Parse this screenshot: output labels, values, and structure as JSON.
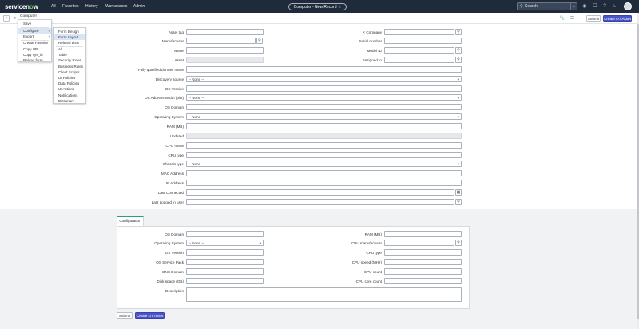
{
  "topbar": {
    "logo_text_a": "servicen",
    "logo_text_o": "o",
    "logo_text_b": "w",
    "nav": [
      "All",
      "Favorites",
      "History",
      "Workspaces",
      "Admin"
    ],
    "record_title": "Computer - New Record ☆",
    "search_placeholder": "Search"
  },
  "form_header": {
    "title": "Computer",
    "submit_label": "Submit",
    "create_label": "Create OT Asset"
  },
  "context_menu": {
    "items": [
      "Save",
      "Configure",
      "Export",
      "Create Favorite",
      "Copy URL",
      "Copy sys_id",
      "Reload form"
    ],
    "active": "Configure"
  },
  "submenu": {
    "items": [
      "Form Design",
      "Form Layout",
      "Related Lists",
      "All",
      "Table",
      "Security Rules",
      "Business Rules",
      "Client Scripts",
      "UI Policies",
      "Data Policies",
      "UI Actions",
      "Notifications",
      "Dictionary"
    ],
    "active": "Form Layout"
  },
  "left_fields": {
    "asset_tag": "Asset tag",
    "manufacturer": "Manufacturer",
    "name": "Name",
    "asset": "Asset",
    "fqdn": "Fully qualified domain name",
    "discovery_source": "Discovery source",
    "os_version": "OS Version",
    "os_address_width": "OS Address Width (bits)",
    "os_domain": "OS Domain",
    "operating_system": "Operating System",
    "ram": "RAM (MB)",
    "updated": "Updated",
    "cpu_name": "CPU name",
    "cpu_type": "CPU type",
    "chassis_type": "Chassis type",
    "mac_address": "MAC Address",
    "ip_address": "IP Address",
    "last_connected": "Last Connected",
    "last_logged_in_user": "Last Logged in user"
  },
  "right_fields": {
    "company": "Company",
    "serial_number": "Serial number",
    "model_id": "Model ID",
    "assigned_to": "Assigned to"
  },
  "none_option": "-- None --",
  "config_tab": {
    "label": "Configuration",
    "left": {
      "os_domain": "OS Domain",
      "operating_system": "Operating System",
      "os_version": "OS Version",
      "os_service_pack": "OS Service Pack",
      "dns_domain": "DNS Domain",
      "disk_space": "Disk space (GB)",
      "description": "Description"
    },
    "right": {
      "ram": "RAM (MB)",
      "cpu_manufacturer": "CPU manufacturer",
      "cpu_type": "CPU type",
      "cpu_speed": "CPU speed (MHz)",
      "cpu_count": "CPU count",
      "cpu_core_count": "CPU core count"
    }
  },
  "bottom": {
    "submit_label": "Submit",
    "create_label": "Create OT Asset"
  },
  "colors": {
    "topbar": "#1f2a3a",
    "primary_button": "#4b55c8",
    "logo_accent": "#62d84e",
    "tab_accent": "#2e9e7a"
  }
}
